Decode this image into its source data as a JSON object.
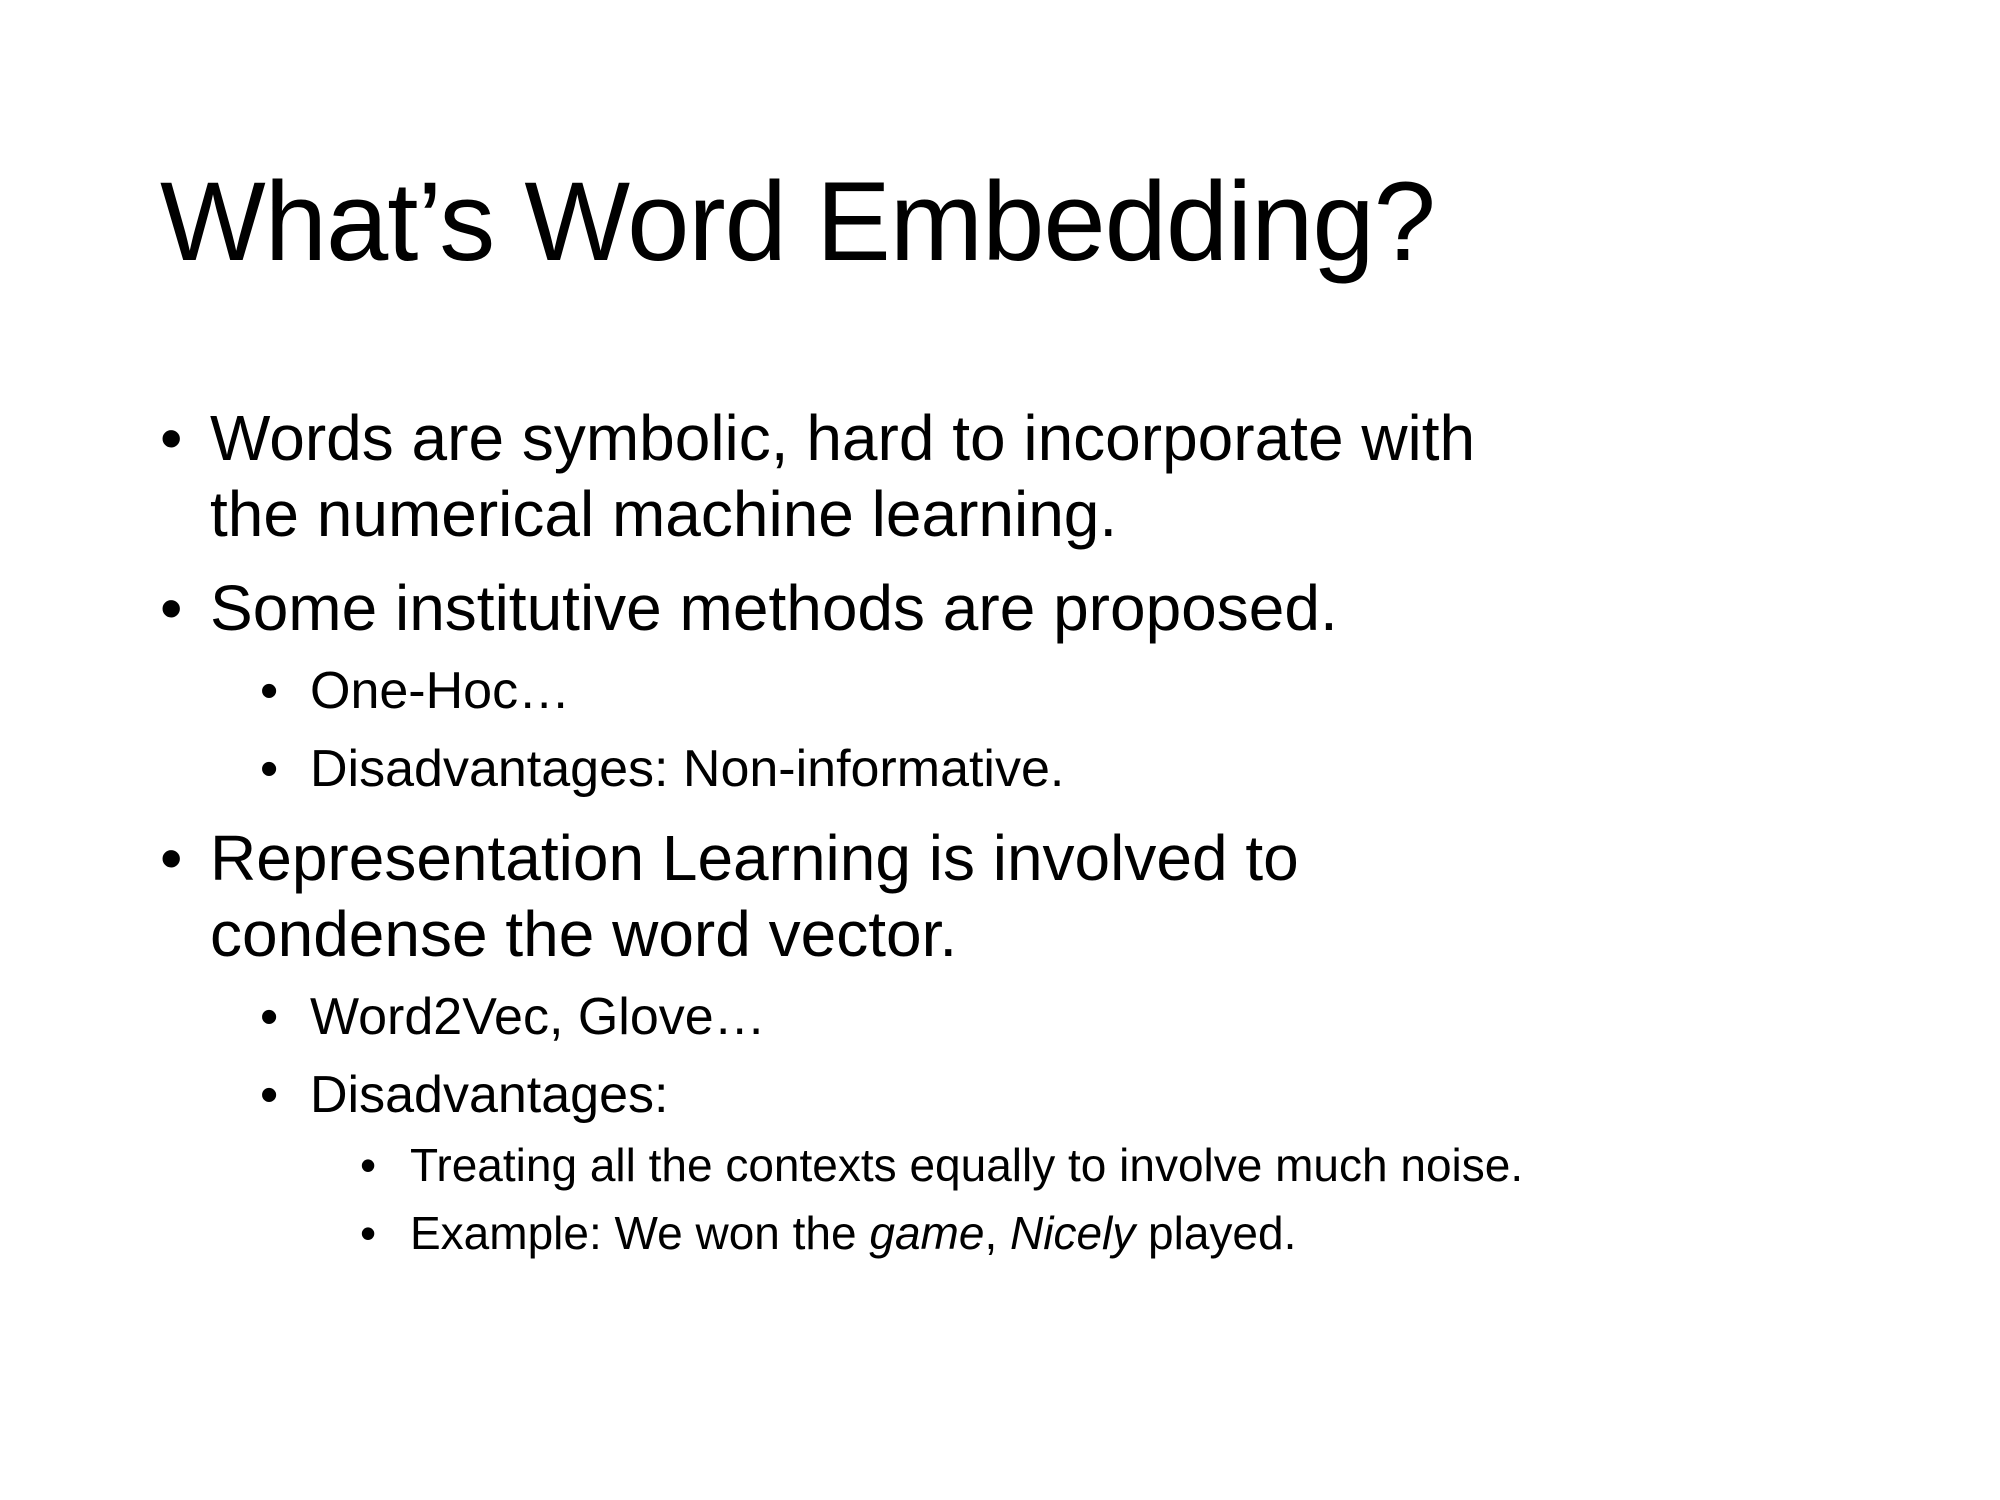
{
  "title": "What’s Word Embedding?",
  "bullet_glyph": "•",
  "items": [
    {
      "text": "Words are symbolic, hard to incorporate with the numerical machine learning."
    },
    {
      "text": "Some institutive methods are proposed.",
      "children": [
        {
          "text": "One-Hoc…"
        },
        {
          "text": "Disadvantages: Non-informative."
        }
      ]
    },
    {
      "text": "Representation Learning is involved to condense the word vector.",
      "children": [
        {
          "text": "Word2Vec, Glove…"
        },
        {
          "text": "Disadvantages:",
          "children": [
            {
              "text": "Treating all the contexts equally to involve much noise."
            },
            {
              "parts": {
                "prefix": "Example: We won the ",
                "italic1": "game",
                "sep": ", ",
                "italic2": "Nicely",
                "suffix": " played."
              }
            }
          ]
        }
      ]
    }
  ]
}
